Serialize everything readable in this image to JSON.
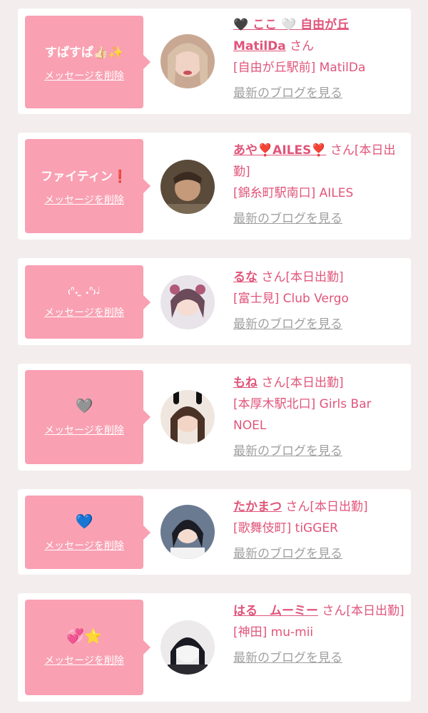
{
  "common": {
    "delete_label": "メッセージを削除",
    "blog_label": "最新のブログを見る"
  },
  "cards": [
    {
      "message": "すぱすぱ👍🏻✨",
      "name": "🖤 ここ 🤍 自由が丘 MatilDa",
      "suffix": "さん",
      "location": "[自由が丘駅前] MatilDa"
    },
    {
      "message": "ファイティン❗",
      "name": "あや❣️AILES❣️",
      "suffix": "さん[本日出勤]",
      "location": "[錦糸町駅南口] AILES"
    },
    {
      "message": "₍ᐢ. ̫ .ᐢ₎♩",
      "name": "るな",
      "suffix": "さん[本日出勤]",
      "location": "[富士見] Club Vergo"
    },
    {
      "message": "🩶",
      "name": "もね",
      "suffix": "さん[本日出勤]",
      "location": "[本厚木駅北口] Girls Bar NOEL"
    },
    {
      "message": "💙",
      "name": "たかまつ",
      "suffix": "さん[本日出勤]",
      "location": "[歌舞伎町] tiGGER"
    },
    {
      "message": "💞⭐",
      "name": "はる　ムーミー",
      "suffix": "さん[本日出勤]",
      "location": "[神田] mu-mii"
    }
  ],
  "colors": {
    "bubble": "#f9a0b2",
    "accent": "#e0557a",
    "muted": "#a0a0a0"
  }
}
